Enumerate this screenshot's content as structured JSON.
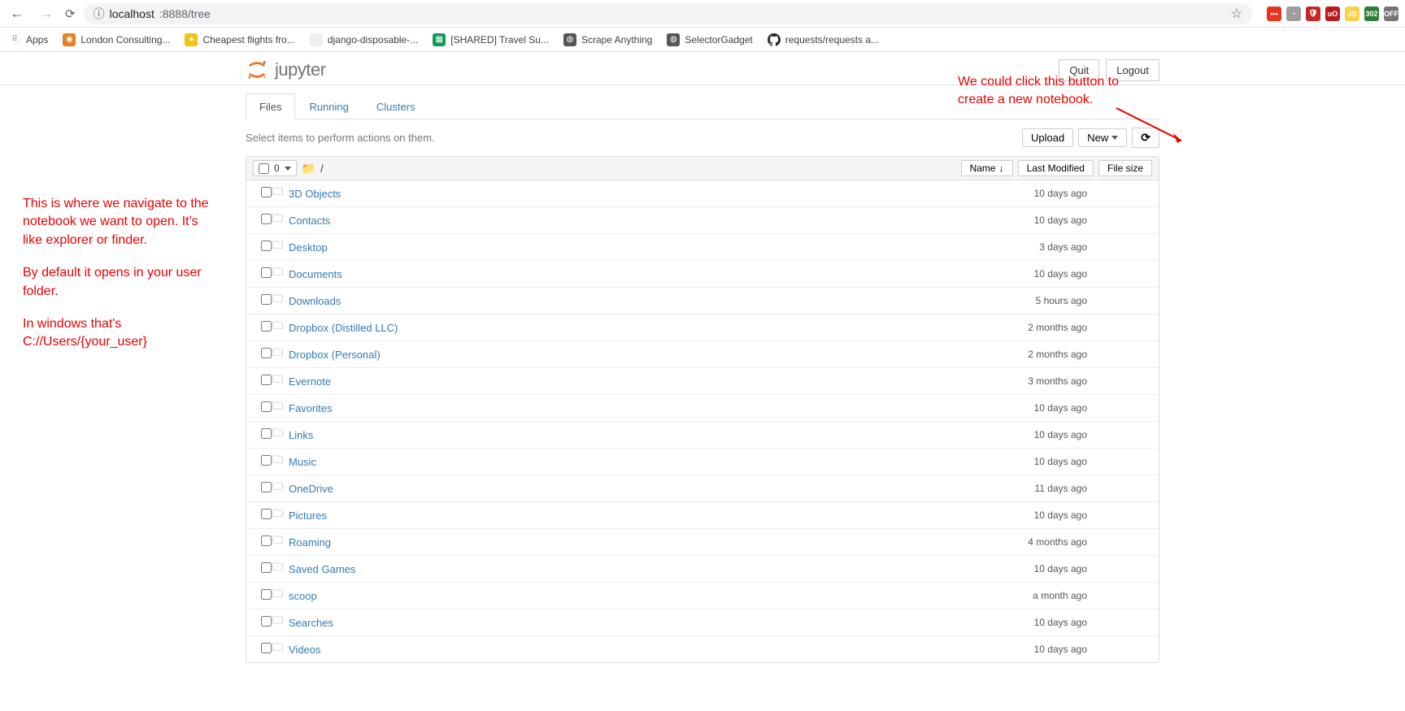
{
  "browser": {
    "url_prefix": "ⓘ  ",
    "url_host": "localhost",
    "url_rest": ":8888/tree"
  },
  "extensions": [
    {
      "bg": "#e8331e",
      "txt": "•••"
    },
    {
      "bg": "#9e9e9e",
      "txt": "◔"
    },
    {
      "bg": "#c62828",
      "txt": "🛡"
    },
    {
      "bg": "#b71c1c",
      "txt": "uO"
    },
    {
      "bg": "#f9d14c",
      "txt": "JS"
    },
    {
      "bg": "#2e7d32",
      "txt": "302"
    },
    {
      "bg": "#757575",
      "txt": "OFF"
    }
  ],
  "bookmarks": [
    {
      "label": "Apps",
      "bg": "#fff",
      "txt": "⠿",
      "color": "#34a853"
    },
    {
      "label": "London Consulting...",
      "bg": "#e67e22",
      "txt": "◉",
      "color": "#fff"
    },
    {
      "label": "Cheapest flights fro...",
      "bg": "#f1c40f",
      "txt": "●",
      "color": "#fff"
    },
    {
      "label": "django-disposable-...",
      "bg": "#eee",
      "txt": "",
      "color": "#555"
    },
    {
      "label": "[SHARED] Travel Su...",
      "bg": "#0f9d58",
      "txt": "▦",
      "color": "#fff"
    },
    {
      "label": "Scrape Anything",
      "bg": "#555",
      "txt": "◍",
      "color": "#fff"
    },
    {
      "label": "SelectorGadget",
      "bg": "#555",
      "txt": "◍",
      "color": "#fff"
    },
    {
      "label": "requests/requests a...",
      "bg": "#24292e",
      "txt": "",
      "color": "#fff",
      "github": true
    }
  ],
  "header": {
    "logo_text": "jupyter",
    "quit": "Quit",
    "logout": "Logout"
  },
  "tabs": {
    "files": "Files",
    "running": "Running",
    "clusters": "Clusters"
  },
  "toolbar": {
    "hint": "Select items to perform actions on them.",
    "upload": "Upload",
    "new": "New",
    "selected_count": "0",
    "breadcrumb": "/"
  },
  "columns": {
    "name": "Name",
    "modified": "Last Modified",
    "size": "File size"
  },
  "files": [
    {
      "name": "3D Objects",
      "date": "10 days ago",
      "size": ""
    },
    {
      "name": "Contacts",
      "date": "10 days ago",
      "size": ""
    },
    {
      "name": "Desktop",
      "date": "3 days ago",
      "size": ""
    },
    {
      "name": "Documents",
      "date": "10 days ago",
      "size": ""
    },
    {
      "name": "Downloads",
      "date": "5 hours ago",
      "size": ""
    },
    {
      "name": "Dropbox (Distilled LLC)",
      "date": "2 months ago",
      "size": ""
    },
    {
      "name": "Dropbox (Personal)",
      "date": "2 months ago",
      "size": ""
    },
    {
      "name": "Evernote",
      "date": "3 months ago",
      "size": ""
    },
    {
      "name": "Favorites",
      "date": "10 days ago",
      "size": ""
    },
    {
      "name": "Links",
      "date": "10 days ago",
      "size": ""
    },
    {
      "name": "Music",
      "date": "10 days ago",
      "size": ""
    },
    {
      "name": "OneDrive",
      "date": "11 days ago",
      "size": ""
    },
    {
      "name": "Pictures",
      "date": "10 days ago",
      "size": ""
    },
    {
      "name": "Roaming",
      "date": "4 months ago",
      "size": ""
    },
    {
      "name": "Saved Games",
      "date": "10 days ago",
      "size": ""
    },
    {
      "name": "scoop",
      "date": "a month ago",
      "size": ""
    },
    {
      "name": "Searches",
      "date": "10 days ago",
      "size": ""
    },
    {
      "name": "Videos",
      "date": "10 days ago",
      "size": ""
    }
  ],
  "annotations": {
    "left_p1": "This is where we navigate to the notebook we want to open. It's like explorer or finder.",
    "left_p2": "By default it opens in your user folder.",
    "left_p3": "In windows that's C://Users/{your_user}",
    "right": "We could click this button to create a new notebook."
  }
}
